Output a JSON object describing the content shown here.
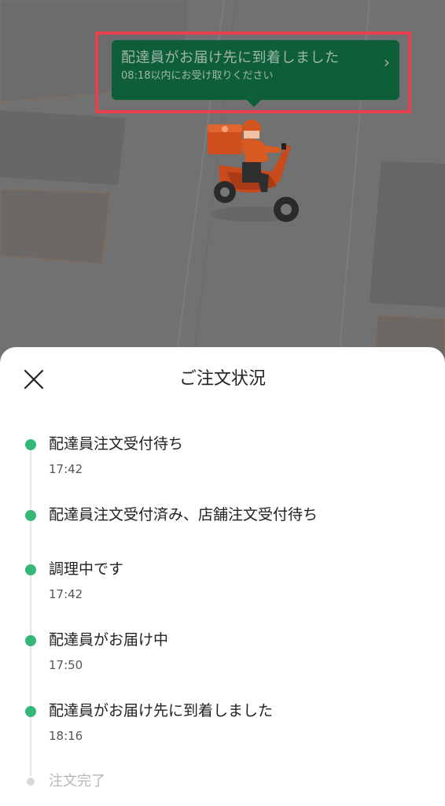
{
  "banner": {
    "title": "配達員がお届け先に到着しました",
    "subtitle": "08:18以内にお受け取りください",
    "chevron": "›"
  },
  "sheet": {
    "title": "ご注文状況",
    "close_icon": "close-icon"
  },
  "timeline": [
    {
      "label": "配達員注文受付待ち",
      "time": "17:42",
      "done": true
    },
    {
      "label": "配達員注文受付済み、店舗注文受付待ち",
      "time": "",
      "done": true
    },
    {
      "label": "調理中です",
      "time": "17:42",
      "done": true
    },
    {
      "label": "配達員がお届け中",
      "time": "17:50",
      "done": true
    },
    {
      "label": "配達員がお届け先に到着しました",
      "time": "18:16",
      "done": true
    },
    {
      "label": "注文完了",
      "time": "",
      "done": false
    }
  ],
  "colors": {
    "accent_green": "#35b779",
    "banner_green": "#0e5e3a",
    "highlight_red": "#e8404e",
    "rider_orange": "#e8622c"
  }
}
